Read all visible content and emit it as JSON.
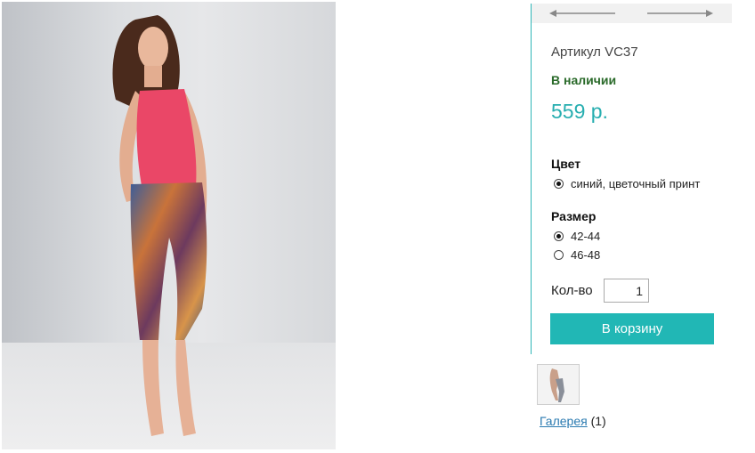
{
  "product": {
    "sku_text": "Артикул VC37",
    "stock_text": "В наличии",
    "price_text": "559 р."
  },
  "options": {
    "color": {
      "title": "Цвет",
      "items": [
        {
          "label": "синий, цветочный принт",
          "selected": true
        }
      ]
    },
    "size": {
      "title": "Размер",
      "items": [
        {
          "label": "42-44",
          "selected": true
        },
        {
          "label": "46-48",
          "selected": false
        }
      ]
    }
  },
  "quantity": {
    "label": "Кол-во",
    "value": "1"
  },
  "cart": {
    "button_label": "В корзину"
  },
  "gallery": {
    "link_text": "Галерея",
    "count_text": "(1)"
  },
  "icons": {
    "prev": "arrow-left-icon",
    "next": "arrow-right-icon"
  },
  "colors": {
    "accent": "#21b7b5",
    "price": "#27aeb0",
    "stock": "#2a6a2a"
  }
}
